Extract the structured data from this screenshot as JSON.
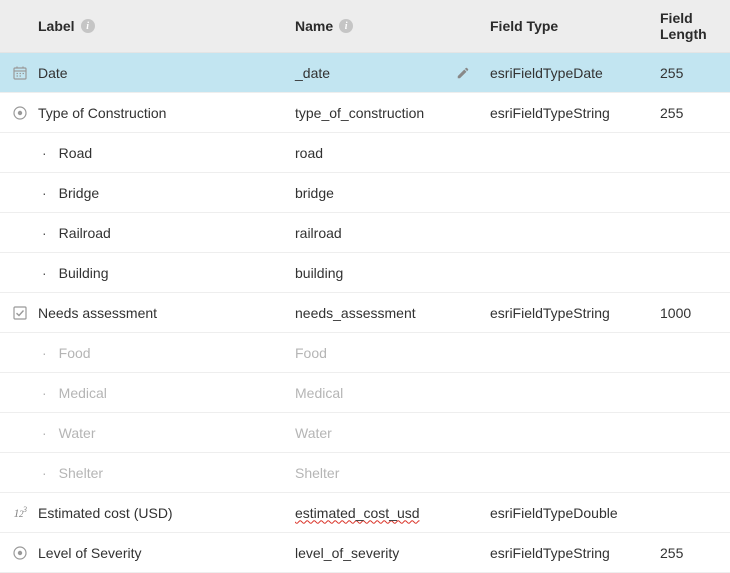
{
  "headers": {
    "label": "Label",
    "name": "Name",
    "fieldType": "Field Type",
    "fieldLength": "Field Length"
  },
  "rows": [
    {
      "icon": "calendar",
      "label": "Date",
      "name": "_date",
      "editable": true,
      "selected": true,
      "fieldType": "esriFieldTypeDate",
      "fieldLength": "255"
    },
    {
      "icon": "radio",
      "label": "Type of Construction",
      "name": "type_of_construction",
      "fieldType": "esriFieldTypeString",
      "fieldLength": "255",
      "options": [
        {
          "label": "Road",
          "name": "road"
        },
        {
          "label": "Bridge",
          "name": "bridge"
        },
        {
          "label": "Railroad",
          "name": "railroad"
        },
        {
          "label": "Building",
          "name": "building"
        }
      ]
    },
    {
      "icon": "checkbox",
      "label": "Needs assessment",
      "name": "needs_assessment",
      "fieldType": "esriFieldTypeString",
      "fieldLength": "1000",
      "optionsMuted": true,
      "options": [
        {
          "label": "Food",
          "name": "Food"
        },
        {
          "label": "Medical",
          "name": "Medical"
        },
        {
          "label": "Water",
          "name": "Water"
        },
        {
          "label": "Shelter",
          "name": "Shelter"
        }
      ]
    },
    {
      "icon": "number",
      "label": "Estimated cost (USD)",
      "name": "estimated_cost_usd",
      "nameSquiggle": true,
      "fieldType": "esriFieldTypeDouble",
      "fieldLength": ""
    },
    {
      "icon": "radio",
      "label": "Level of Severity",
      "name": "level_of_severity",
      "fieldType": "esriFieldTypeString",
      "fieldLength": "255"
    }
  ]
}
